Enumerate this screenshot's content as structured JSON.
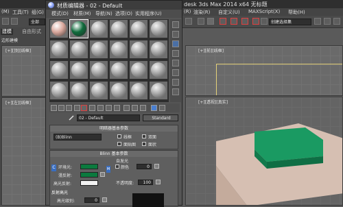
{
  "max_window": {
    "title_left": "",
    "title_right": "desk 3ds Max  2014 x64     无标题",
    "menu_left": [
      "(M)",
      "工具(T)",
      "组(G)"
    ],
    "menu_right": [
      "(R)",
      "渲染(R)",
      "自定义(U)",
      "MAXScript(X)",
      "帮助(H)"
    ],
    "toolbar_dropdown": "全部",
    "right_dropdown": "创建选择集",
    "left_tabs": [
      "建模",
      "自由形式"
    ],
    "left_label": "边形建模",
    "viewports": {
      "top_left": "[+][顶][线框]",
      "top_right": "[+][前][线框]",
      "bottom_left": "[+][左][线框]",
      "bottom_right": "[+][透视][真实]"
    }
  },
  "material_editor": {
    "title": "材质编辑器 - 02 - Default",
    "menu": [
      "模式(D)",
      "材质(M)",
      "导航(N)",
      "选项(O)",
      "实用程序(U)"
    ],
    "slot_colors": [
      "#d9a79c",
      "#0f6b3c"
    ],
    "material_name": "02 - Default",
    "material_type": "Standard",
    "rollout_shader": {
      "title": "明暗器基本参数",
      "shader": "(B)Blinn",
      "options": [
        "线框",
        "双面",
        "面贴图",
        "面状"
      ]
    },
    "rollout_blinn": {
      "title": "Blinn 基本参数",
      "self_illum_title": "自发光",
      "color_label": "颜色",
      "color_value": "0",
      "ambient_label": "环境光:",
      "diffuse_label": "漫反射:",
      "specular_label": "高光反射:",
      "opacity_label": "不透明度:",
      "opacity_value": "100",
      "ambient_color": "#0b7a3e",
      "diffuse_color": "#0b7a3e",
      "specular_color": "#f2f2f2",
      "lock_label": "C",
      "side_button": "M"
    },
    "rollout_specular": {
      "title": "反射高光",
      "level_label": "高光级别:",
      "level_value": "0"
    }
  },
  "colors": {
    "green_box": "#119660",
    "base_box": "#d8c2b6"
  }
}
